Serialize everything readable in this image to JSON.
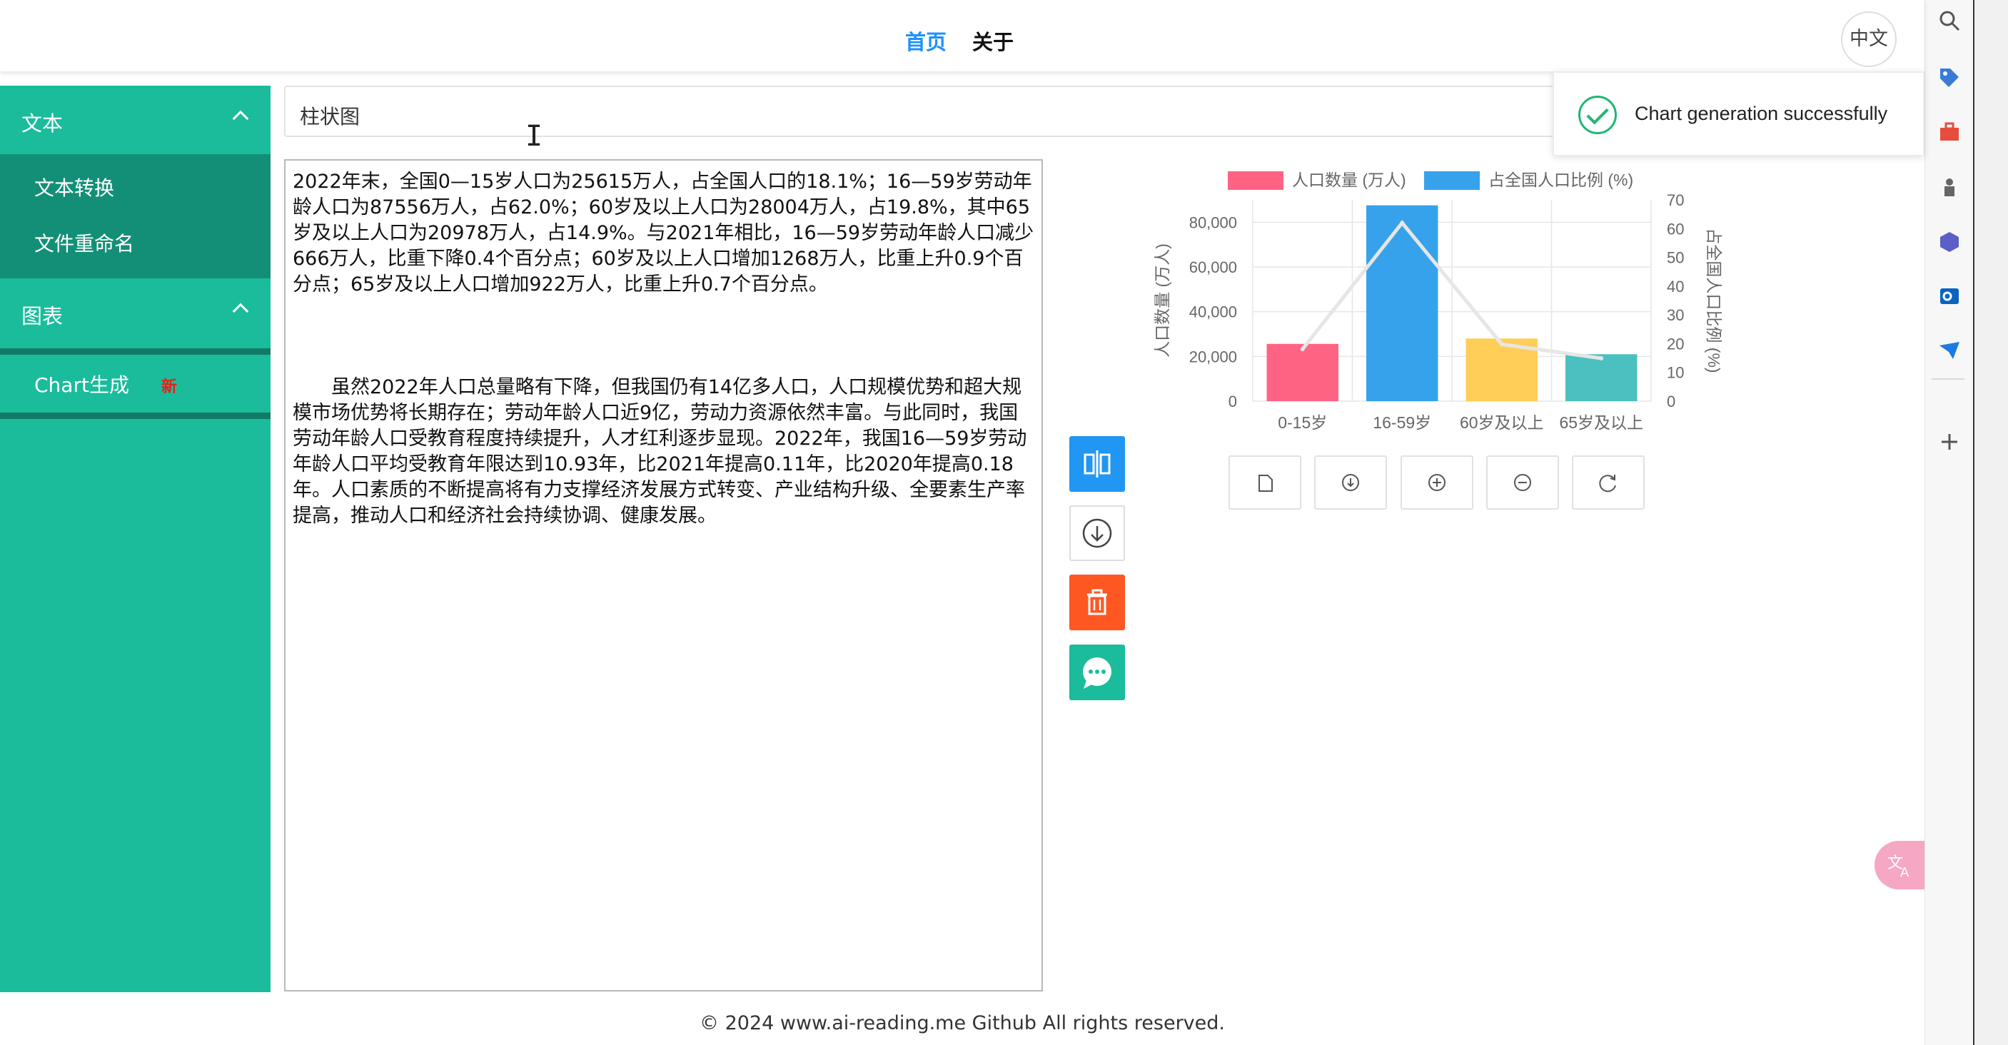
{
  "header": {
    "nav": {
      "home": "首页",
      "about": "关于"
    },
    "lang_button": "中文"
  },
  "sidebar": {
    "groups": [
      {
        "label": "文本",
        "items": [
          "文本转换",
          "文件重命名"
        ]
      },
      {
        "label": "图表",
        "items": [
          "Chart生成"
        ],
        "new_badge": "新"
      }
    ]
  },
  "chart_type_input": {
    "value": "柱状图"
  },
  "textarea": {
    "paragraph1": "2022年末，全国0—15岁人口为25615万人，占全国人口的18.1%；16—59岁劳动年龄人口为87556万人，占62.0%；60岁及以上人口为28004万人，占19.8%，其中65岁及以上人口为20978万人，占14.9%。与2021年相比，16—59岁劳动年龄人口减少666万人，比重下降0.4个百分点；60岁及以上人口增加1268万人，比重上升0.9个百分点；65岁及以上人口增加922万人，比重上升0.7个百分点。",
    "paragraph2": "虽然2022年人口总量略有下降，但我国仍有14亿多人口，人口规模优势和超大规模市场优势将长期存在；劳动年龄人口近9亿，劳动力资源依然丰富。与此同时，我国劳动年龄人口受教育程度持续提升，人才红利逐步显现。2022年，我国16—59岁劳动年龄人口平均受教育年限达到10.93年，比2021年提高0.11年，比2020年提高0.18年。人口素质的不断提高将有力支撑经济发展方式转变、产业结构升级、全要素生产率提高，推动人口和经济社会持续协调、健康发展。"
  },
  "actions": [
    "compare-icon",
    "download-circle-icon",
    "trash-icon",
    "chat-bubble-icon"
  ],
  "chart_data": {
    "type": "bar",
    "categories": [
      "0-15岁",
      "16-59岁",
      "60岁及以上",
      "65岁及以上"
    ],
    "series": [
      {
        "name": "人口数量 (万人)",
        "values": [
          25615,
          87556,
          28004,
          20978
        ],
        "axis": "left",
        "render": "bar"
      },
      {
        "name": "占全国人口比例 (%)",
        "values": [
          18.1,
          62.0,
          19.8,
          14.9
        ],
        "axis": "right",
        "render": "line"
      }
    ],
    "bar_colors": [
      "#ff6384",
      "#36a2eb",
      "#ffce56",
      "#4bc0c0"
    ],
    "line_color": "#e6e6e6",
    "legend_colors": [
      "#ff6384",
      "#36a2eb"
    ],
    "ylabel": "人口数量 (万人)",
    "ylabel_right": "占全国人口比例 (%)",
    "ylim": [
      0,
      90000
    ],
    "ylim_right": [
      0,
      70
    ],
    "yticks": [
      "0",
      "20,000",
      "40,000",
      "60,000",
      "80,000"
    ],
    "yticks_right": [
      "0",
      "10",
      "20",
      "30",
      "40",
      "50",
      "60",
      "70"
    ],
    "legend_position": "top",
    "grid": true
  },
  "chart_tools": [
    "document-icon",
    "download-icon",
    "zoom-in-icon",
    "zoom-out-icon",
    "refresh-icon"
  ],
  "toast": {
    "message": "Chart generation successfully"
  },
  "footer": {
    "text": "© 2024 www.ai-reading.me Github All rights reserved."
  },
  "colors": {
    "accent": "#1abc9c",
    "primary": "#2196f3",
    "danger": "#ff5722",
    "success": "#22b573"
  }
}
